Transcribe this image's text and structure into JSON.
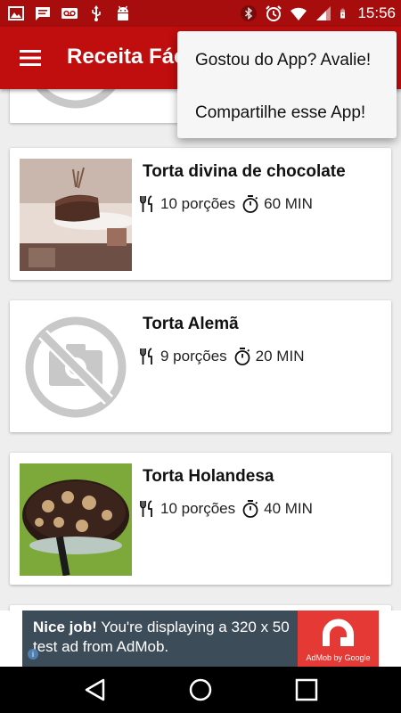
{
  "status_bar": {
    "time": "15:56",
    "left_icons": [
      "image-icon",
      "message-icon",
      "voicemail-icon",
      "usb-icon",
      "android-debug-icon"
    ],
    "right_icons": [
      "bluetooth-icon",
      "alarm-icon",
      "wifi-icon",
      "signal-icon",
      "battery-icon"
    ]
  },
  "app_bar": {
    "title": "Receita Fácil",
    "menu_icon": "menu-icon"
  },
  "overflow_menu": {
    "items": [
      {
        "label": "Gostou do App? Avalie!"
      },
      {
        "label": "Compartilhe esse App!"
      }
    ]
  },
  "recipes": [
    {
      "title": "Torta divina de chocolate",
      "servings": "10 porções",
      "time": "60 MIN",
      "image": "chocolate-cake-photo"
    },
    {
      "title": "Torta Alemã",
      "servings": "9 porções",
      "time": "20 MIN",
      "image": "no-photo-icon"
    },
    {
      "title": "Torta Holandesa",
      "servings": "10 porções",
      "time": "40 MIN",
      "image": "dutch-pie-photo"
    }
  ],
  "ad": {
    "headline": "Nice job!",
    "body": " You're displaying a 320 x 50 test ad from AdMob.",
    "brand": "AdMob by Google"
  },
  "nav_bar": {
    "icons": [
      "back-icon",
      "home-icon",
      "recents-icon"
    ]
  },
  "colors": {
    "status_bar": "#a80d0d",
    "app_bar": "#c00d0d",
    "background": "#eeeeee",
    "ad_banner": "#3d4c59",
    "ad_logo": "#e53935"
  }
}
